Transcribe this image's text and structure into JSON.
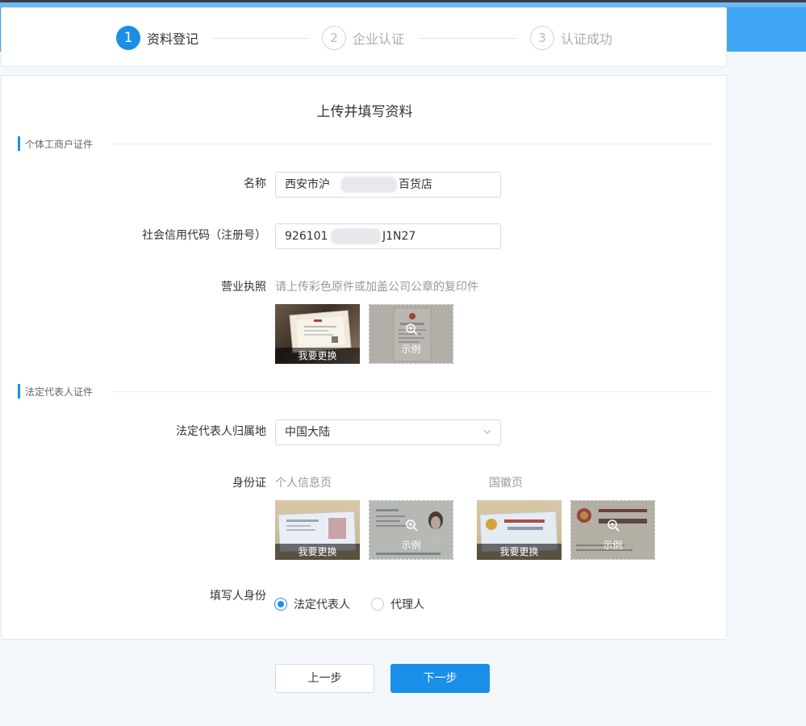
{
  "steps": [
    {
      "num": "1",
      "label": "资料登记"
    },
    {
      "num": "2",
      "label": "企业认证"
    },
    {
      "num": "3",
      "label": "认证成功"
    }
  ],
  "form": {
    "title": "上传并填写资料",
    "section_business": "个体工商户证件",
    "section_legal": "法定代表人证件",
    "name_label": "名称",
    "name_prefix": "西安市沪",
    "name_suffix": "百货店",
    "code_label": "社会信用代码（注册号）",
    "code_prefix": "926101",
    "code_suffix": "J1N27",
    "license_label": "营业执照",
    "license_hint": "请上传彩色原件或加盖公司公章的复印件",
    "replace_label": "我要更换",
    "example_label": "示例",
    "region_label": "法定代表人归属地",
    "region_value": "中国大陆",
    "idcard_label": "身份证",
    "idcard_personal": "个人信息页",
    "idcard_emblem": "国徽页",
    "filler_label": "填写人身份",
    "filler_options": [
      "法定代表人",
      "代理人"
    ]
  },
  "buttons": {
    "prev": "上一步",
    "next": "下一步"
  },
  "colors": {
    "accent": "#1a8fe8",
    "header": "#3ea4f4"
  }
}
